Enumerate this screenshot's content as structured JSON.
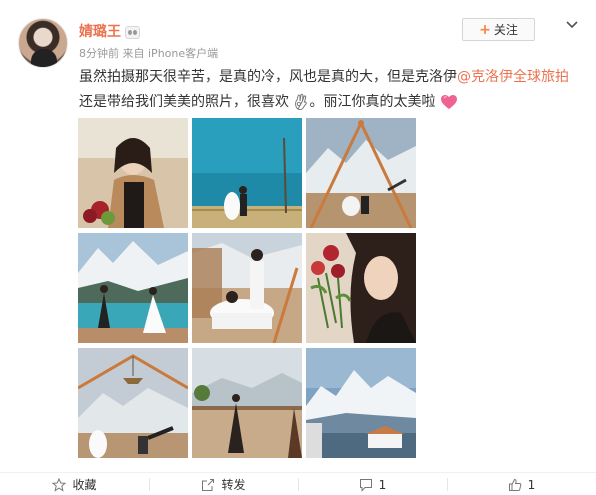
{
  "post": {
    "username": "婧璐王",
    "time": "8分钟前",
    "source_prefix": "来自",
    "source": "iPhone客户端",
    "follow_label": "关注",
    "text_line1_a": "虽然拍摄那天很辛苦，是真的冷，风也是真的大，但是克洛伊",
    "mention": "@克洛伊全球旅拍",
    "text_line2_a": "还是带给我们美美的照片，很喜欢",
    "text_line2_b": "。丽江你真的太美啦"
  },
  "photos": [
    {
      "name": "bride-portrait-flowers"
    },
    {
      "name": "lake-dock-couple"
    },
    {
      "name": "mountain-frame-couple"
    },
    {
      "name": "snow-mountain-lake-couple"
    },
    {
      "name": "bathtub-couple"
    },
    {
      "name": "woman-with-roses"
    },
    {
      "name": "chandelier-telescope-couple"
    },
    {
      "name": "terrace-couple-mountains"
    },
    {
      "name": "snow-mountain-house"
    }
  ],
  "footer": {
    "favorite_label": "收藏",
    "repost_label": "转发",
    "comment_count": "1",
    "like_count": "1"
  },
  "colors": {
    "accent": "#eb7350",
    "link": "#eb7350",
    "heart": "#f06292"
  }
}
